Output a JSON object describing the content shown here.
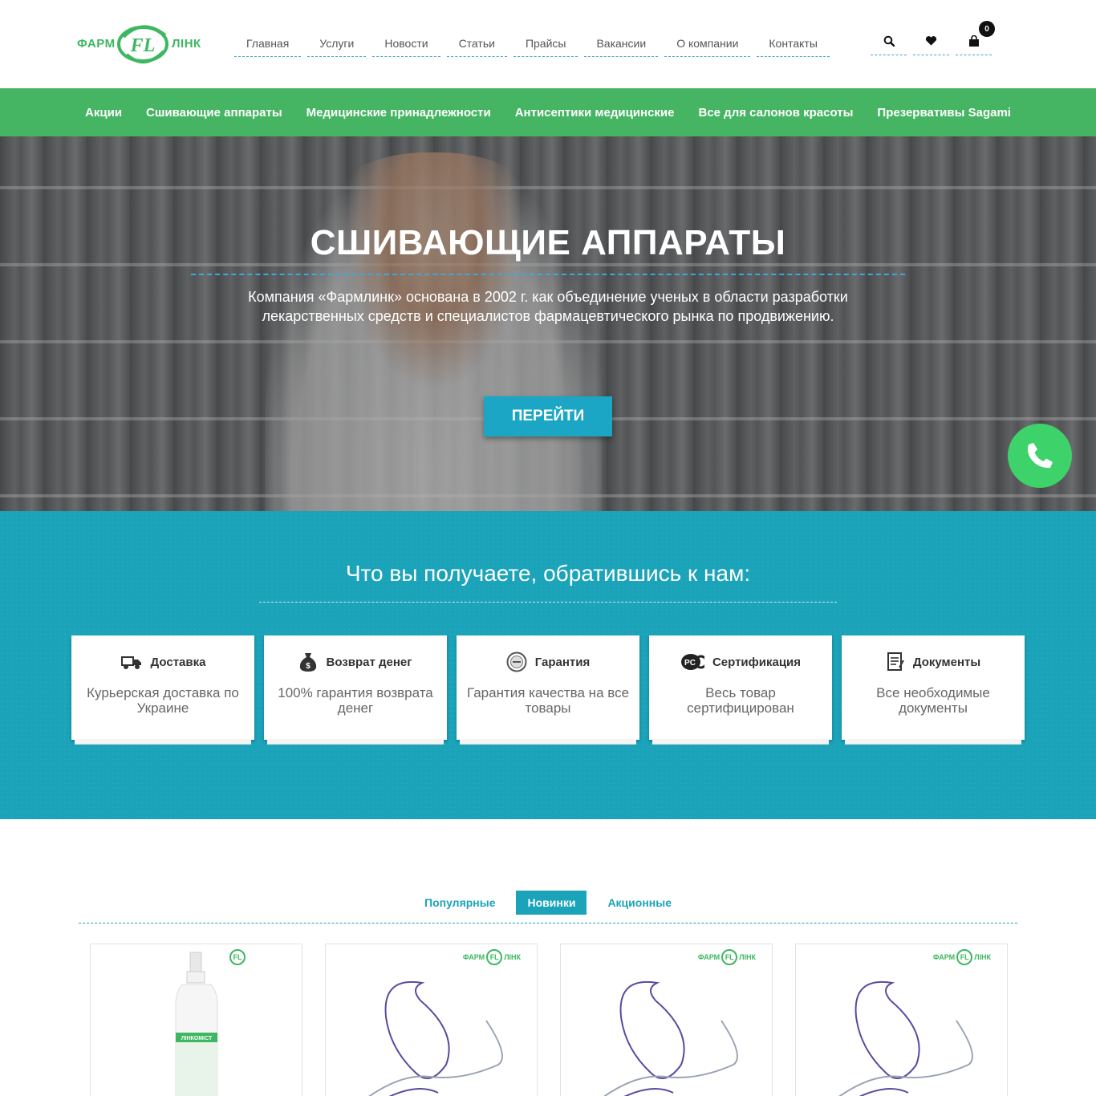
{
  "logo": {
    "left": "ФАРМ",
    "mark": "FL",
    "right": "ЛІНК"
  },
  "topnav": [
    "Главная",
    "Услуги",
    "Новости",
    "Статьи",
    "Прайсы",
    "Вакансии",
    "О компании",
    "Контакты"
  ],
  "cart": {
    "count": "0"
  },
  "categories": [
    "Акции",
    "Сшивающие аппараты",
    "Медицинские принадлежности",
    "Антисептики медицинские",
    "Все для салонов красоты",
    "Презервативы Sagami"
  ],
  "hero": {
    "title": "СШИВАЮЩИЕ АППАРАТЫ",
    "text": "Компания «Фармлинк» основана в 2002 г. как объединение ученых в области разработки лекарственных средств и специалистов фармацевтического рынка по продвижению.",
    "button": "ПЕРЕЙТИ"
  },
  "benefits": {
    "title": "Что вы получаете, обратившись к нам:",
    "cards": [
      {
        "icon": "delivery-truck-icon",
        "title": "Доставка",
        "text": "Курьерская доставка по Украине"
      },
      {
        "icon": "money-bag-icon",
        "title": "Возврат денег",
        "text": "100% гарантия возврата денег"
      },
      {
        "icon": "guarantee-seal-icon",
        "title": "Гарантия",
        "text": "Гарантия качества на все товары"
      },
      {
        "icon": "certification-icon",
        "title": "Сертификация",
        "text": "Весь товар сертифицирован"
      },
      {
        "icon": "document-icon",
        "title": "Документы",
        "text": "Все необходимые документы"
      }
    ]
  },
  "products": {
    "tabs": [
      "Популярные",
      "Новинки",
      "Акционные"
    ],
    "active_tab": "Новинки",
    "items": [
      {
        "image": "spray-bottle",
        "label": "ЛІНКОМІСТ"
      },
      {
        "image": "suture-thread"
      },
      {
        "image": "suture-thread"
      },
      {
        "image": "suture-thread"
      }
    ],
    "product_logo": {
      "left": "ФАРМ",
      "mark": "FL",
      "right": "ЛІНК"
    }
  },
  "colors": {
    "green": "#46b563",
    "teal": "#1aa3b9",
    "call": "#3dd36a"
  }
}
